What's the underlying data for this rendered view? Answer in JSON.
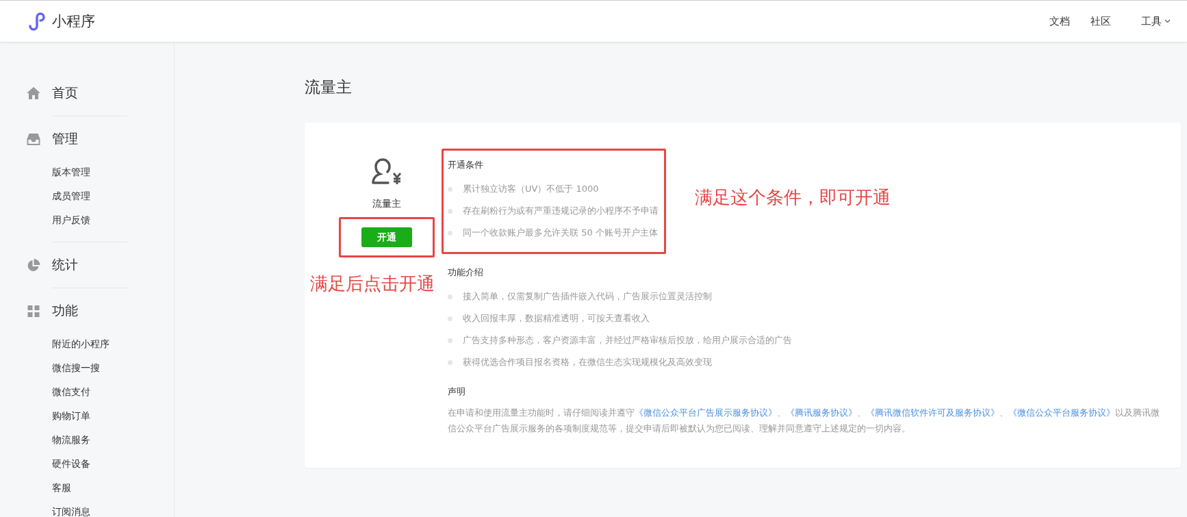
{
  "header": {
    "logo_text": "小程序",
    "nav": [
      {
        "label": "文档"
      },
      {
        "label": "社区"
      }
    ],
    "tools": {
      "label": "工具"
    }
  },
  "sidebar": [
    {
      "title": "首页"
    },
    {
      "title": "管理",
      "items": [
        "版本管理",
        "成员管理",
        "用户反馈"
      ]
    },
    {
      "title": "统计"
    },
    {
      "title": "功能",
      "items": [
        "附近的小程序",
        "微信搜一搜",
        "微信支付",
        "购物订单",
        "物流服务",
        "硬件设备",
        "客服",
        "订阅消息"
      ]
    }
  ],
  "page_title": "流量主",
  "card": {
    "icon_label": "流量主",
    "button": "开通",
    "conditions": {
      "title": "开通条件",
      "items": [
        "累计独立访客（UV）不低于 1000",
        "存在刷粉行为或有严重违规记录的小程序不予申请",
        "同一个收款账户最多允许关联 50 个账号开户主体"
      ]
    },
    "features": {
      "title": "功能介绍",
      "items": [
        "接入简单，仅需复制广告插件嵌入代码，广告展示位置灵活控制",
        "收入回报丰厚，数据精准透明，可按天查看收入",
        "广告支持多种形态，客户资源丰富，并经过严格审核后投放，给用户展示合适的广告",
        "获得优选合作项目报名资格，在微信生态实现规模化及高效变现"
      ]
    },
    "declaration": {
      "title": "声明",
      "parts": [
        {
          "kind": "text",
          "text": "在申请和使用流量主功能时，请仔细阅读并遵守"
        },
        {
          "kind": "link",
          "text": "《微信公众平台广告展示服务协议》"
        },
        {
          "kind": "text",
          "text": "、"
        },
        {
          "kind": "link",
          "text": "《腾讯服务协议》"
        },
        {
          "kind": "text",
          "text": "、"
        },
        {
          "kind": "link",
          "text": "《腾讯微信软件许可及服务协议》"
        },
        {
          "kind": "text",
          "text": "、"
        },
        {
          "kind": "link",
          "text": "《微信公众平台服务协议》"
        },
        {
          "kind": "text",
          "text": "以及腾讯微信公众平台广告展示服务的各项制度规范等，提交申请后即被默认为您已阅读、理解并同意遵守上述规定的一切内容。"
        }
      ]
    }
  },
  "annotations": [
    {
      "kind": "conditions",
      "text": "满足这个条件，即可开通"
    },
    {
      "kind": "button",
      "text": "满足后点击开通"
    }
  ]
}
